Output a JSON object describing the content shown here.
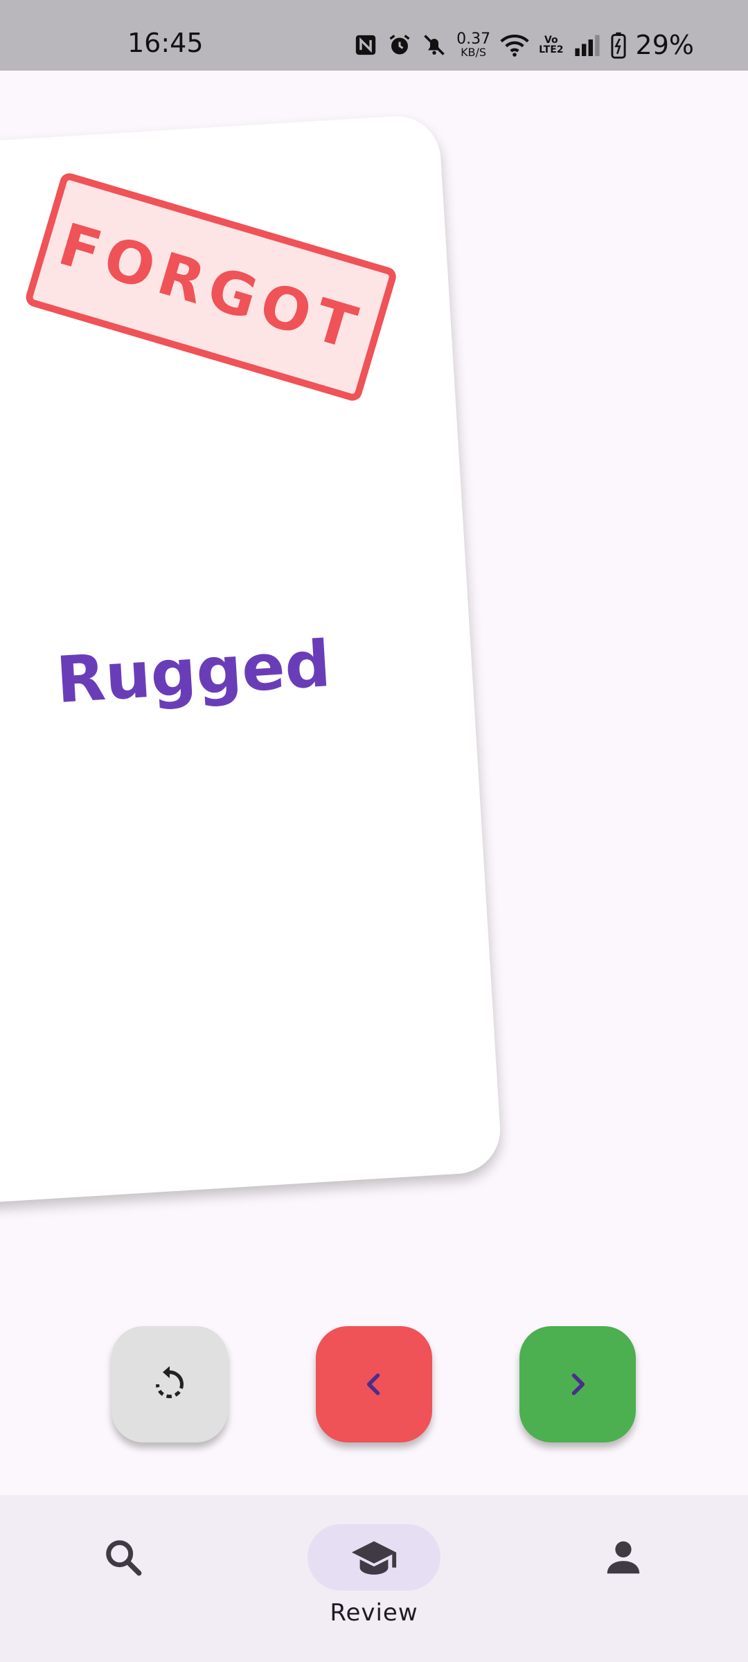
{
  "status_bar": {
    "time": "16:45",
    "net_speed_value": "0.37",
    "net_speed_unit": "KB/S",
    "volte_top": "Vo",
    "volte_bottom": "LTE2",
    "battery_percent": "29%",
    "icons": [
      "nfc-icon",
      "alarm-icon",
      "bell-off-icon",
      "wifi-icon",
      "volte-icon",
      "signal-icon",
      "battery-charging-icon"
    ]
  },
  "card": {
    "stamp": "FORGOT",
    "word": "Rugged"
  },
  "actions": [
    {
      "name": "reset",
      "icon": "reset-icon",
      "color": "#e0e0e0"
    },
    {
      "name": "forgot",
      "icon": "chevron-left-icon",
      "color": "#ef5257"
    },
    {
      "name": "remember",
      "icon": "chevron-right-icon",
      "color": "#4caf50"
    }
  ],
  "bottom_nav": {
    "items": [
      {
        "icon": "search-icon",
        "label": "",
        "active": false
      },
      {
        "icon": "graduation-cap-icon",
        "label": "Review",
        "active": true
      },
      {
        "icon": "person-icon",
        "label": "",
        "active": false
      }
    ]
  },
  "colors": {
    "accent_purple": "#6a3db8",
    "forgot_red": "#ef5257",
    "remember_green": "#4caf50",
    "nav_active_pill": "#e6dff3"
  }
}
